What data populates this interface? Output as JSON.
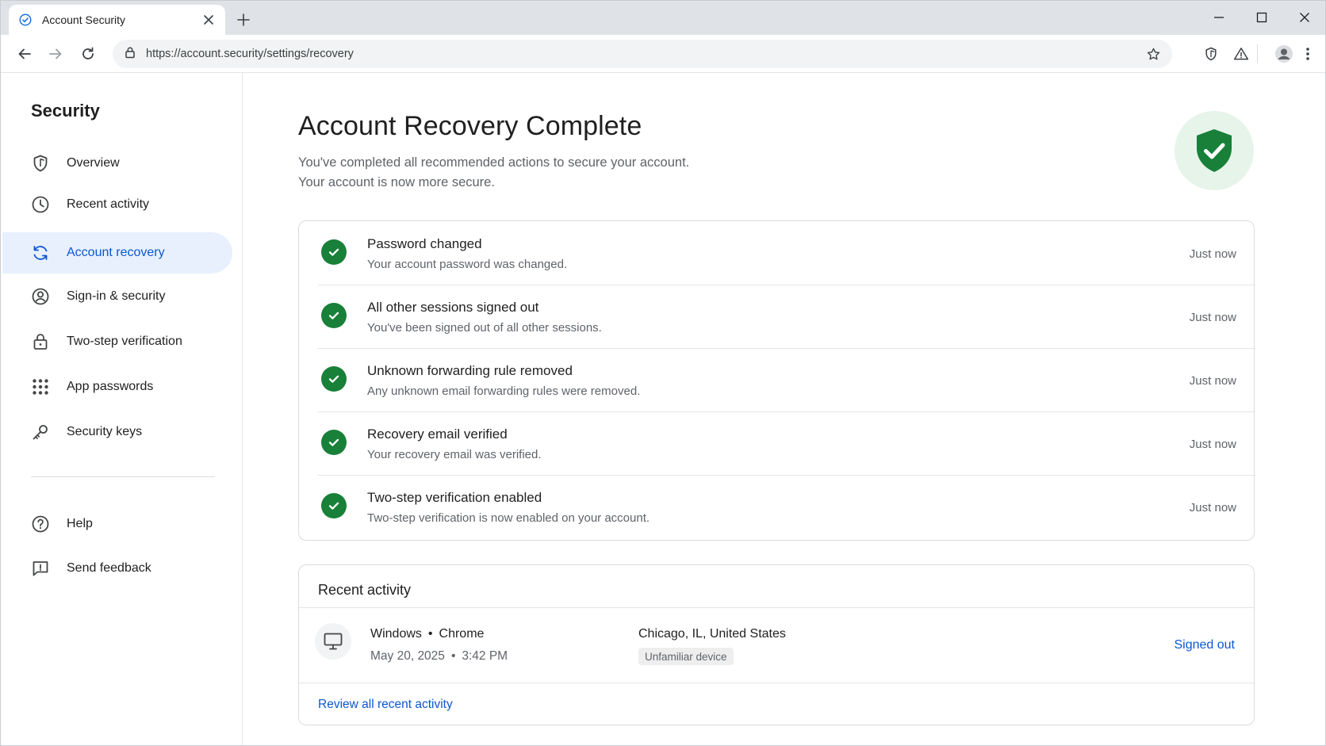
{
  "browser": {
    "tab_title": "Account Security",
    "url": "https://account.security/settings/recovery"
  },
  "sidebar": {
    "title": "Security",
    "items": [
      {
        "label": "Overview",
        "icon": "shield-icon"
      },
      {
        "label": "Recent activity",
        "icon": "clock-icon"
      },
      {
        "label": "Account recovery",
        "icon": "refresh-icon",
        "active": true
      },
      {
        "label": "Sign-in & security",
        "icon": "user-circle-icon"
      },
      {
        "label": "Two-step verification",
        "icon": "lock-icon"
      },
      {
        "label": "App passwords",
        "icon": "grid-icon"
      },
      {
        "label": "Security keys",
        "icon": "key-icon"
      }
    ],
    "footer_items": [
      {
        "label": "Help",
        "icon": "help-icon"
      },
      {
        "label": "Send feedback",
        "icon": "feedback-icon"
      }
    ]
  },
  "main": {
    "title": "Account Recovery Complete",
    "subtitle_line1": "You've completed all recommended actions to secure your account.",
    "subtitle_line2": "Your account is now more secure.",
    "actions": [
      {
        "title": "Password changed",
        "desc": "Your account password was changed.",
        "time": "Just now"
      },
      {
        "title": "All other sessions signed out",
        "desc": "You've been signed out of all other sessions.",
        "time": "Just now"
      },
      {
        "title": "Unknown forwarding rule removed",
        "desc": "Any unknown email forwarding rules were removed.",
        "time": "Just now"
      },
      {
        "title": "Recovery email verified",
        "desc": "Your recovery email was verified.",
        "time": "Just now"
      },
      {
        "title": "Two-step verification enabled",
        "desc": "Two-step verification is now enabled on your account.",
        "time": "Just now"
      }
    ],
    "recent_activity": {
      "title": "Recent activity",
      "os": "Windows",
      "browser": "Chrome",
      "date": "May 20, 2025",
      "time": "3:42 PM",
      "separator": "•",
      "location": "Chicago, IL, United States",
      "badge": "Unfamiliar device",
      "status": "Signed out",
      "review_link": "Review all recent activity"
    }
  },
  "colors": {
    "accent": "#0b57d0",
    "active_bg": "#e8f0fe",
    "success": "#188038",
    "success_bg": "#e6f4ea"
  }
}
